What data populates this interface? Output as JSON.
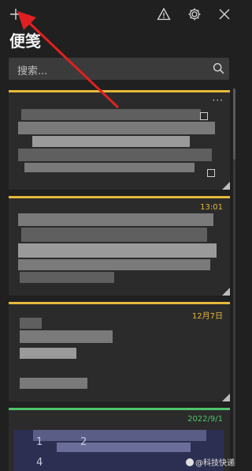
{
  "app": {
    "title": "便笺"
  },
  "toolbar": {
    "add_icon": "plus-icon",
    "alert_icon": "warning-icon",
    "settings_icon": "gear-icon",
    "close_icon": "close-icon"
  },
  "search": {
    "placeholder": "搜索..."
  },
  "notes": [
    {
      "timestamp": "",
      "accent": "#e6b83a"
    },
    {
      "timestamp": "13:01",
      "accent": "#e6b83a"
    },
    {
      "timestamp": "12月7日",
      "accent": "#e6b83a"
    },
    {
      "timestamp": "2022/9/1",
      "accent": "#4fc36b"
    }
  ],
  "note4_keypad": [
    "1",
    "2",
    "4"
  ],
  "watermark": {
    "text": "@科技快递"
  },
  "colors": {
    "annotation_arrow": "#e02020"
  }
}
